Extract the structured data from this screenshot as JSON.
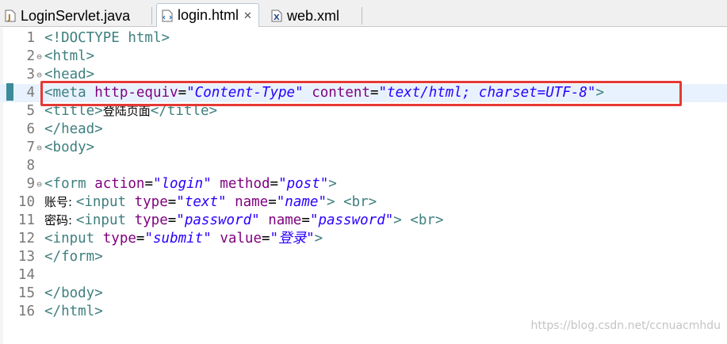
{
  "tabs": [
    {
      "label": "LoginServlet.java",
      "icon": "java-file-icon",
      "active": false
    },
    {
      "label": "login.html",
      "icon": "html-file-icon",
      "active": true,
      "close": "✕"
    },
    {
      "label": "web.xml",
      "icon": "xml-file-icon",
      "active": false
    }
  ],
  "editor": {
    "current_line": 4,
    "lines": [
      {
        "n": "1",
        "fold": "",
        "tokens": [
          [
            "tag",
            "<!DOCTYPE html>"
          ]
        ]
      },
      {
        "n": "2",
        "fold": "⊖",
        "tokens": [
          [
            "tag",
            "<html>"
          ]
        ]
      },
      {
        "n": "3",
        "fold": "⊖",
        "tokens": [
          [
            "tag",
            "<head>"
          ]
        ]
      },
      {
        "n": "4",
        "fold": "",
        "tokens": [
          [
            "tag",
            "<meta "
          ],
          [
            "attr",
            "http-equiv"
          ],
          [
            "plain",
            "="
          ],
          [
            "val",
            "\"Content-Type\""
          ],
          [
            "plain",
            " "
          ],
          [
            "attr",
            "content"
          ],
          [
            "plain",
            "="
          ],
          [
            "val",
            "\"text/html; charset=UTF-8\""
          ],
          [
            "tag",
            ">"
          ]
        ]
      },
      {
        "n": "5",
        "fold": "",
        "tokens": [
          [
            "tag",
            "<title>"
          ],
          [
            "cjk",
            "登陆页面"
          ],
          [
            "tag",
            "</title>"
          ]
        ]
      },
      {
        "n": "6",
        "fold": "",
        "tokens": [
          [
            "tag",
            "</head>"
          ]
        ]
      },
      {
        "n": "7",
        "fold": "⊖",
        "tokens": [
          [
            "tag",
            "<body>"
          ]
        ]
      },
      {
        "n": "8",
        "fold": "",
        "tokens": []
      },
      {
        "n": "9",
        "fold": "⊖",
        "tokens": [
          [
            "tag",
            "<form "
          ],
          [
            "attr",
            "action"
          ],
          [
            "plain",
            "="
          ],
          [
            "val",
            "\"login\""
          ],
          [
            "plain",
            " "
          ],
          [
            "attr",
            "method"
          ],
          [
            "plain",
            "="
          ],
          [
            "val",
            "\"post\""
          ],
          [
            "tag",
            ">"
          ]
        ]
      },
      {
        "n": "10",
        "fold": "",
        "tokens": [
          [
            "cjk",
            "账号: "
          ],
          [
            "tag",
            "<input "
          ],
          [
            "attr",
            "type"
          ],
          [
            "plain",
            "="
          ],
          [
            "val",
            "\"text\""
          ],
          [
            "plain",
            " "
          ],
          [
            "attr",
            "name"
          ],
          [
            "plain",
            "="
          ],
          [
            "val",
            "\"name\""
          ],
          [
            "tag",
            ">"
          ],
          [
            "plain",
            " "
          ],
          [
            "tag",
            "<br>"
          ]
        ]
      },
      {
        "n": "11",
        "fold": "",
        "tokens": [
          [
            "cjk",
            "密码: "
          ],
          [
            "tag",
            "<input "
          ],
          [
            "attr",
            "type"
          ],
          [
            "plain",
            "="
          ],
          [
            "val",
            "\"password\""
          ],
          [
            "plain",
            " "
          ],
          [
            "attr",
            "name"
          ],
          [
            "plain",
            "="
          ],
          [
            "val",
            "\"password\""
          ],
          [
            "tag",
            ">"
          ],
          [
            "plain",
            " "
          ],
          [
            "tag",
            "<br>"
          ]
        ]
      },
      {
        "n": "12",
        "fold": "",
        "tokens": [
          [
            "tag",
            "<input "
          ],
          [
            "attr",
            "type"
          ],
          [
            "plain",
            "="
          ],
          [
            "val",
            "\"submit\""
          ],
          [
            "plain",
            " "
          ],
          [
            "attr",
            "value"
          ],
          [
            "plain",
            "="
          ],
          [
            "val",
            "\"登录\""
          ],
          [
            "tag",
            ">"
          ]
        ]
      },
      {
        "n": "13",
        "fold": "",
        "tokens": [
          [
            "tag",
            "</form>"
          ]
        ]
      },
      {
        "n": "14",
        "fold": "",
        "tokens": []
      },
      {
        "n": "15",
        "fold": "",
        "tokens": [
          [
            "tag",
            "</body>"
          ]
        ]
      },
      {
        "n": "16",
        "fold": "",
        "tokens": [
          [
            "tag",
            "</html>"
          ]
        ]
      }
    ]
  },
  "watermark": "https://blog.csdn.net/ccnuacmhdu",
  "colors": {
    "tag": "#3f7f7f",
    "attribute": "#7f007f",
    "value": "#2a00ff",
    "current_line": "#e8f2fe",
    "highlight_box": "#e53935"
  }
}
